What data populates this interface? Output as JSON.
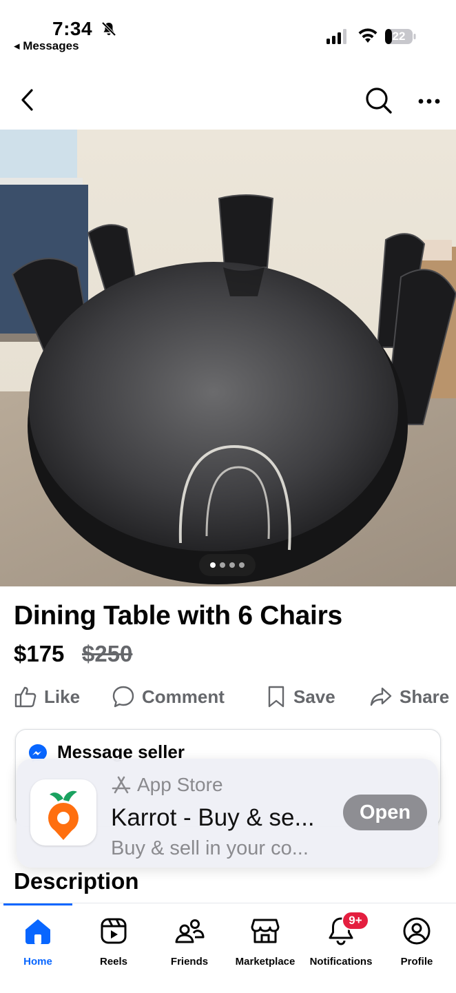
{
  "status_bar": {
    "time": "7:34",
    "back_app": "◂ Messages",
    "battery": "22"
  },
  "navbar": {
    "icons": [
      "chevron-left-icon",
      "search-icon",
      "more-icon"
    ]
  },
  "photo": {
    "carousel_pages": 4,
    "current_page": 1
  },
  "listing": {
    "title": "Dining Table with 6 Chairs",
    "price": "$175",
    "original_price": "$250"
  },
  "actions": {
    "like": "Like",
    "comment": "Comment",
    "save": "Save",
    "share": "Share"
  },
  "message_card": {
    "title": "Message seller"
  },
  "app_banner": {
    "store": "App Store",
    "app_name": "Karrot - Buy & se...",
    "subtitle": "Buy & sell in your co...",
    "open_label": "Open"
  },
  "description_heading": "Description",
  "tabbar": {
    "tabs": [
      {
        "label": "Home",
        "icon": "home-icon",
        "active": true
      },
      {
        "label": "Reels",
        "icon": "reels-icon"
      },
      {
        "label": "Friends",
        "icon": "friends-icon"
      },
      {
        "label": "Marketplace",
        "icon": "marketplace-icon"
      },
      {
        "label": "Notifications",
        "icon": "bell-icon"
      },
      {
        "label": "Profile",
        "icon": "profile-icon"
      }
    ],
    "notification_badge": "9+"
  },
  "colors": {
    "accent": "#0866ff",
    "badge": "#e41e3f",
    "muted": "#65676b"
  }
}
